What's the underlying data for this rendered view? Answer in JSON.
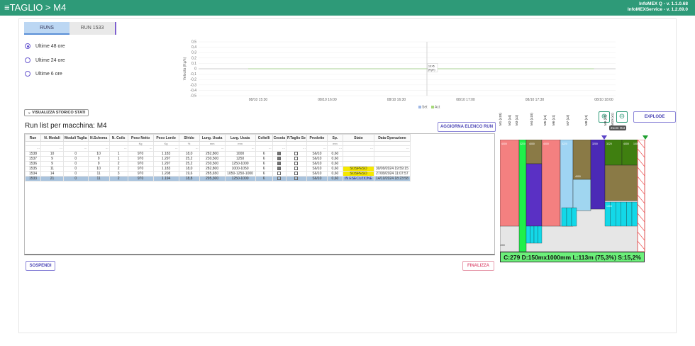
{
  "header": {
    "title": "TAGLIO > M4",
    "menu_icon": "menu-icon",
    "version1": "InfoMEX Q - v. 1.1.0.68",
    "version2": "InfoMEXService - v. 1.2.69.0"
  },
  "tabs": [
    {
      "label": "RUNS"
    },
    {
      "label": "RUN 1533"
    }
  ],
  "radios": [
    {
      "label": "Ultime 48 ore",
      "selected": true
    },
    {
      "label": "Ultime 24 ore",
      "selected": false
    },
    {
      "label": "Ultime 6 ore",
      "selected": false
    }
  ],
  "chart_data": {
    "type": "line",
    "ylabel": "Velocità (Kg/h)",
    "ylim": [
      -0.5,
      0.5
    ],
    "yticks": [
      "0,5",
      "0,4",
      "0,3",
      "0,2",
      "0,1",
      "0",
      "-0,1",
      "-0,2",
      "-0,3",
      "-0,4",
      "-0,5"
    ],
    "xticks": [
      "08/10 15:30",
      "08/10 16:00",
      "08/10 16:30",
      "08/10 17:00",
      "08/10 17:30",
      "08/10 18:00"
    ],
    "series": [
      {
        "name": "Set",
        "color": "#9fb8e6",
        "values": [
          0,
          0,
          0,
          0,
          0,
          0
        ]
      },
      {
        "name": "Act",
        "color": "#a7d97a",
        "values": [
          0,
          0,
          0,
          0,
          0,
          0
        ]
      }
    ],
    "cursor_label": "16:45",
    "cursor_unit": "(Kg/h)",
    "legend": "bottom-right"
  },
  "buttons": {
    "storico": "VISUALIZZA STORICO STATI",
    "aggiorna": "AGGIORNA ELENCO RUN",
    "explode": "EXPLODE",
    "sospendi": "SOSPENDI",
    "finalizza": "FINALIZZA",
    "zoom_out_tip": "Zoom Out"
  },
  "page_title": "Run list per macchina: M4",
  "table": {
    "headers": [
      "Run",
      "N. Moduli",
      "Moduli Taglia",
      "N.Schema",
      "N. Coils",
      "Peso Netto",
      "Peso Lordo",
      "Sfrido",
      "Lung. Usata",
      "Larg. Usata",
      "Coltelli",
      "Cesoia",
      "P.Taglio Se",
      "Prodotto",
      "Sp.",
      "Stato",
      "Data Operazione"
    ],
    "units": [
      "",
      "",
      "",
      "",
      "",
      "Kg",
      "Kg",
      "%",
      "mm",
      "mm",
      "",
      "",
      "",
      "",
      "mm",
      "",
      ""
    ],
    "rows": [
      [
        "1538",
        "10",
        "0",
        "10",
        "1",
        "970",
        "1.183",
        "18,0",
        "282,800",
        "1000",
        "6",
        "on",
        "off",
        "S6/10",
        "0,60",
        "",
        ""
      ],
      [
        "1537",
        "9",
        "0",
        "9",
        "1",
        "970",
        "1.297",
        "25,2",
        "230,500",
        "1250",
        "6",
        "on",
        "off",
        "S6/10",
        "0,60",
        "",
        ""
      ],
      [
        "1536",
        "9",
        "0",
        "9",
        "2",
        "970",
        "1.297",
        "25,2",
        "230,500",
        "1250-1000",
        "6",
        "on",
        "off",
        "S6/10",
        "0,60",
        "",
        ""
      ],
      [
        "1535",
        "11",
        "0",
        "10",
        "2",
        "970",
        "1.183",
        "18,0",
        "282,800",
        "1000-1050",
        "6",
        "on",
        "off",
        "S6/10",
        "0,60",
        "SOSPESO",
        "30/09/2024 19:59:15"
      ],
      [
        "1534",
        "14",
        "0",
        "11",
        "3",
        "970",
        "1.208",
        "19,6",
        "285,650",
        "1050-1250-1000",
        "6",
        "off",
        "off",
        "S6/10",
        "0,60",
        "SOSPESO",
        "27/09/2024 11:07:57"
      ],
      [
        "1533",
        "21",
        "0",
        "11",
        "2",
        "970",
        "1.194",
        "18,8",
        "295,300",
        "1250-1000",
        "6",
        "off",
        "off",
        "S6/10",
        "0,60",
        "IN ESECUZIONE",
        "14/10/2024 18:23:58"
      ]
    ]
  },
  "visual": {
    "labels": [
      "M1 (x10)",
      "M2 (x4)",
      "M3 (x2)",
      "M4 (x10)",
      "M5 (x1)",
      "M6 (x1)",
      "M7 (x3)",
      "M8 (x1)",
      "M9 (x1)",
      "M10 (x1)"
    ],
    "values": [
      "4000",
      "3220",
      "4000",
      "4000",
      "3220",
      "4000",
      "3200",
      "3220",
      "4000",
      "1000",
      "1300"
    ],
    "footer": "C:279 D:150mx1000mm L:113m (75,3%) S:15,2%",
    "axis_top": "1125000",
    "axis_left": "1000"
  }
}
